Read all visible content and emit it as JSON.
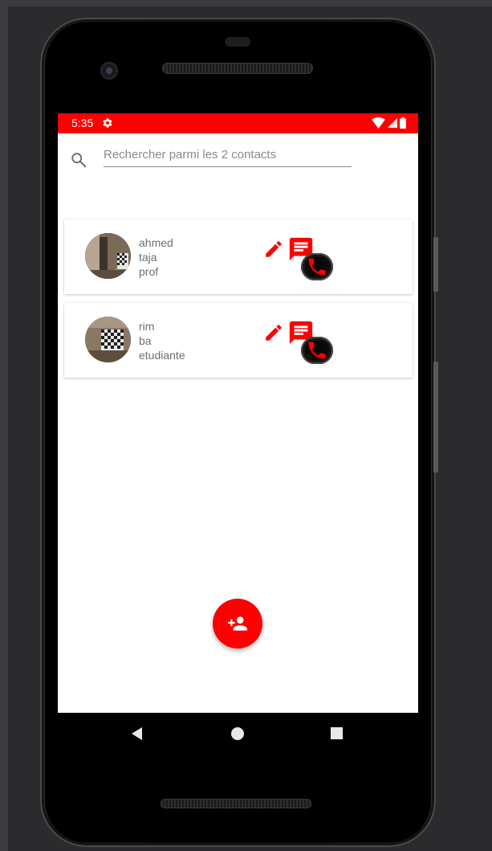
{
  "status_bar": {
    "time": "5:35",
    "background_color": "#fd0000",
    "icons": [
      "settings-icon",
      "wifi-icon",
      "signal-icon",
      "battery-icon"
    ]
  },
  "search": {
    "value": "",
    "placeholder": "Rechercher parmi les 2 contacts",
    "icon": "search-icon"
  },
  "contacts": [
    {
      "first_name": "ahmed",
      "last_name": "taja",
      "role": "prof",
      "actions": [
        "edit-icon",
        "phone-icon",
        "message-icon"
      ]
    },
    {
      "first_name": "rim",
      "last_name": "ba",
      "role": "etudiante",
      "actions": [
        "edit-icon",
        "phone-icon",
        "message-icon"
      ]
    }
  ],
  "fab": {
    "icon": "add-person-icon",
    "color": "#fd0000"
  },
  "navigation": {
    "buttons": [
      "back-icon",
      "home-icon",
      "recents-icon"
    ]
  },
  "colors": {
    "accent": "#fd0000",
    "text_secondary": "#6e6e6e"
  }
}
